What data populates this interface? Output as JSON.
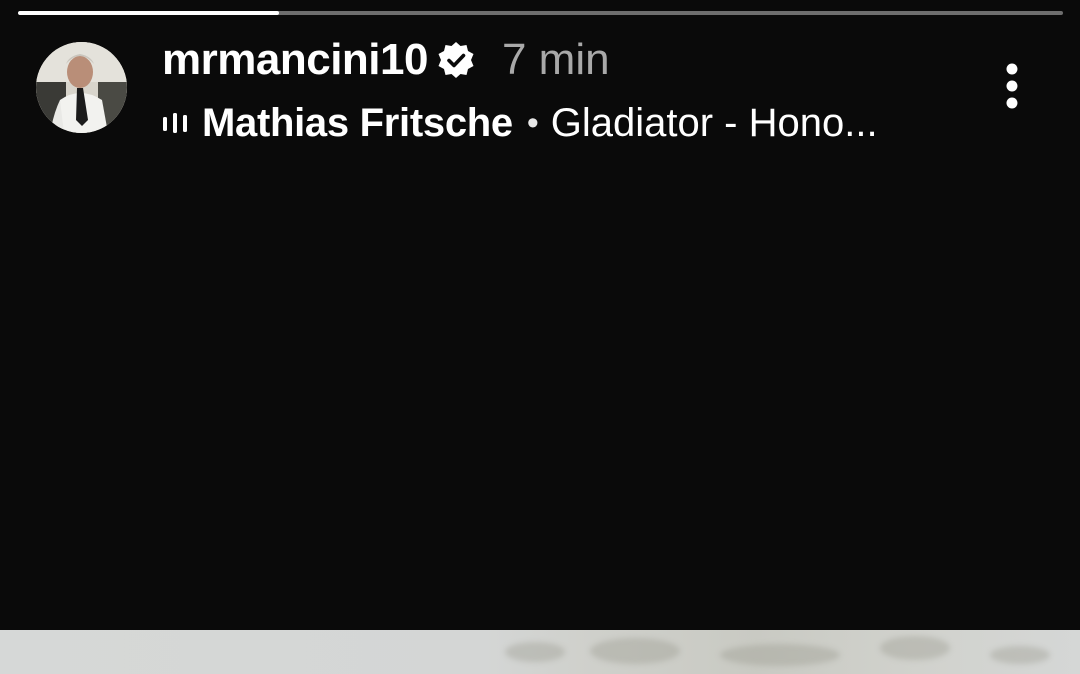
{
  "story": {
    "progress": 0.25
  },
  "header": {
    "username": "mrmancini10",
    "verified": true,
    "time_ago": "7 min",
    "music": {
      "artist": "Mathias Fritsche",
      "separator": "•",
      "track": "Gladiator - Hono..."
    }
  },
  "icons": {
    "verified": "verified-badge-icon",
    "music": "audio-bars-icon",
    "more": "more-vertical-icon"
  },
  "colors": {
    "background": "#0a0a0a",
    "progress_fill": "#ffffff",
    "progress_track": "#6e6e6e",
    "time_text": "#a9a9a9"
  }
}
